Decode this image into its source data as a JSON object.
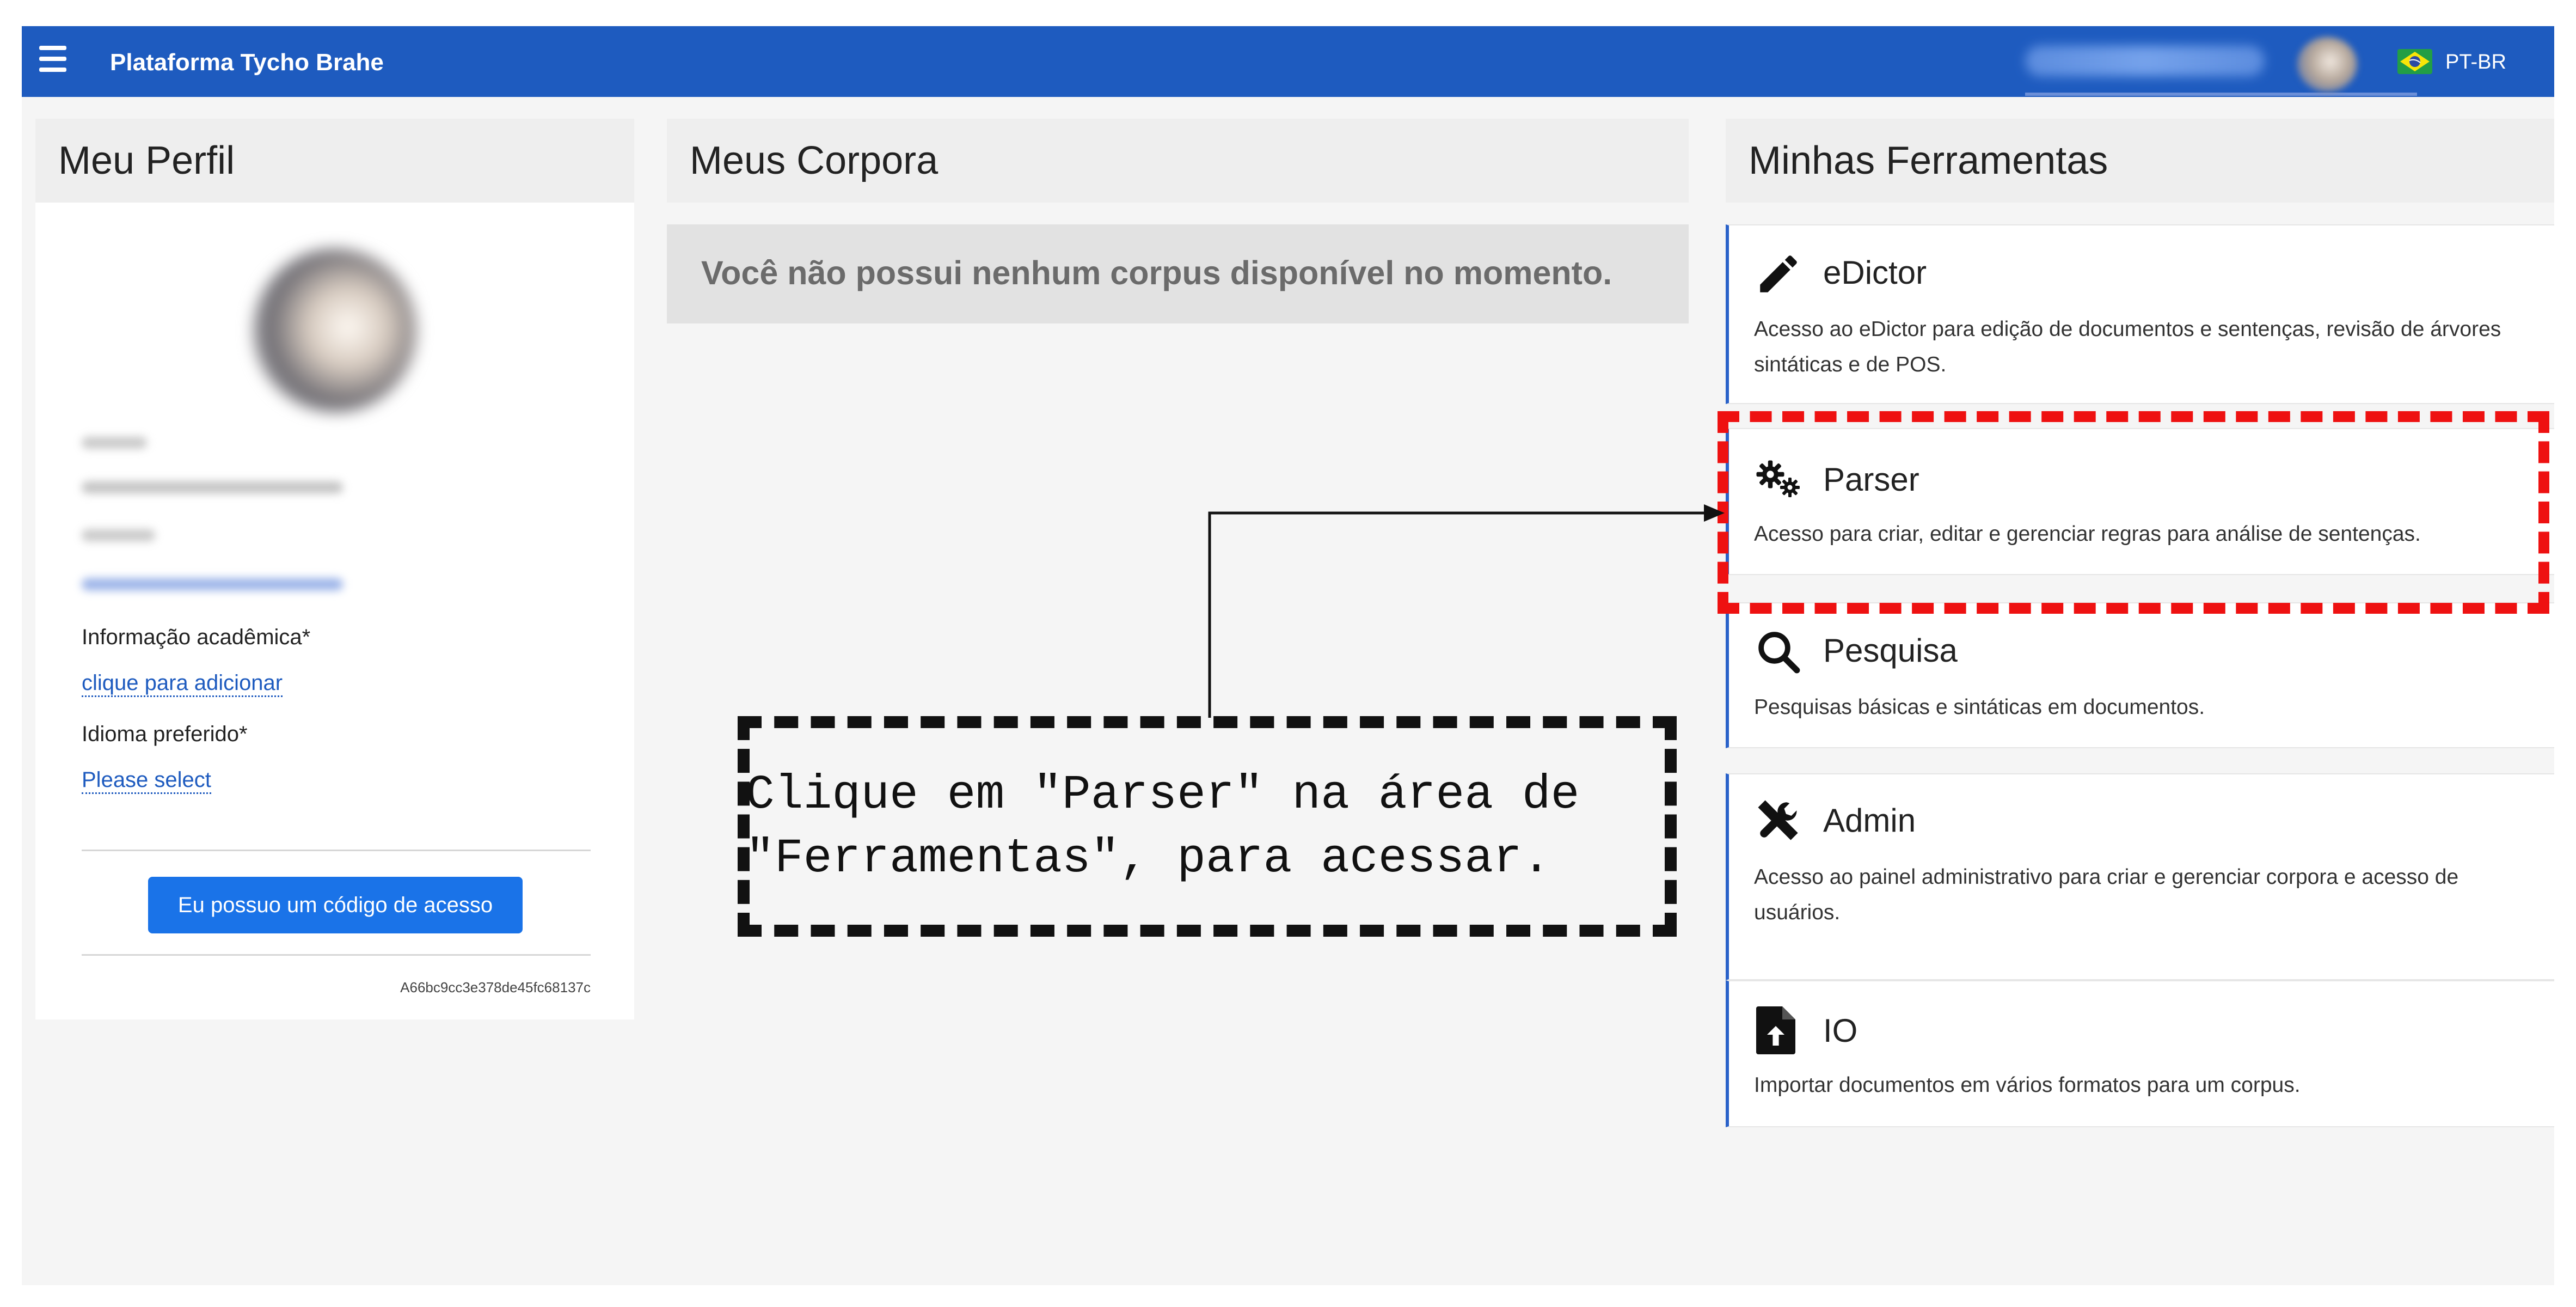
{
  "header": {
    "app_title": "Plataforma Tycho Brahe",
    "language": "PT-BR",
    "menu_icon": "hamburger-menu-icon",
    "user_name_note": "blurred",
    "flag_icon": "brazil-flag-icon",
    "background_color": "#1e5bbf"
  },
  "profile": {
    "title": "Meu Perfil",
    "academic_info_label": "Informação acadêmica*",
    "academic_info_link": "clique para adicionar",
    "preferred_language_label": "Idioma preferido*",
    "preferred_language_link": "Please select",
    "access_code_button": "Eu possuo um código de acesso",
    "hash": "A66bc9cc3e378de45fc68137c"
  },
  "corpora": {
    "title": "Meus Corpora",
    "empty_message": "Você não possui nenhum corpus disponível no momento."
  },
  "tools": {
    "title": "Minhas Ferramentas",
    "items": [
      {
        "name": "eDictor",
        "icon": "pencil-icon",
        "description": "Acesso ao eDictor para edição de documentos e sentenças, revisão de árvores sintáticas e de POS."
      },
      {
        "name": "Parser",
        "icon": "cogs-icon",
        "description": "Acesso para criar, editar e gerenciar regras para análise de sentenças."
      },
      {
        "name": "Pesquisa",
        "icon": "search-icon",
        "description": "Pesquisas básicas e sintáticas em documentos."
      },
      {
        "name": "Admin",
        "icon": "tools-icon",
        "description": "Acesso ao painel administrativo para criar e gerenciar corpora e acesso de usuários."
      },
      {
        "name": "IO",
        "icon": "file-upload-icon",
        "description": "Importar documentos em vários formatos para um corpus."
      }
    ]
  },
  "annotation": {
    "text_line_1": "Clique em \"Parser\" na área de",
    "text_line_2": "\"Ferramentas\", para acessar.",
    "highlight_color": "#ee1111"
  }
}
